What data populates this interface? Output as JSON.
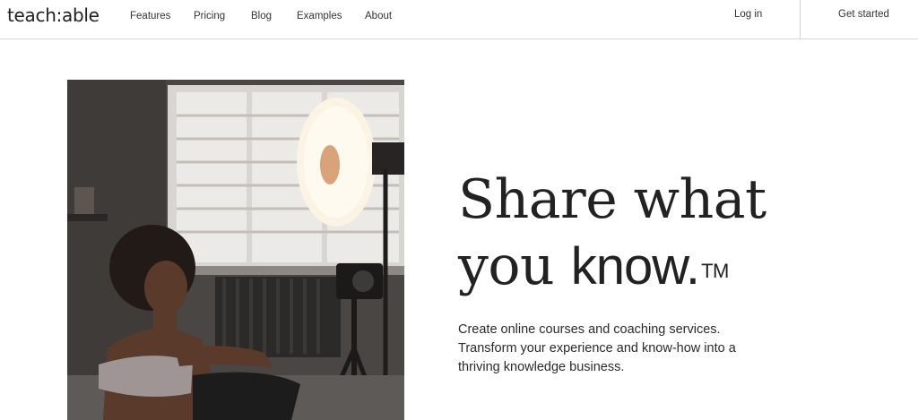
{
  "header": {
    "logo": "teach:able",
    "nav": [
      "Features",
      "Pricing",
      "Blog",
      "Examples",
      "About"
    ],
    "login": "Log in",
    "get_started": "Get started"
  },
  "hero": {
    "headline_line1": "Share what",
    "headline_line2_prefix": "you ",
    "headline_line2_word": "know.",
    "trademark": "TM",
    "subtext": "Create online courses and coaching services. Transform your experience and know-how into a thriving knowledge business."
  },
  "colors": {
    "text": "#1f1f1f",
    "border": "#d9d9d9",
    "background": "#ffffff"
  }
}
